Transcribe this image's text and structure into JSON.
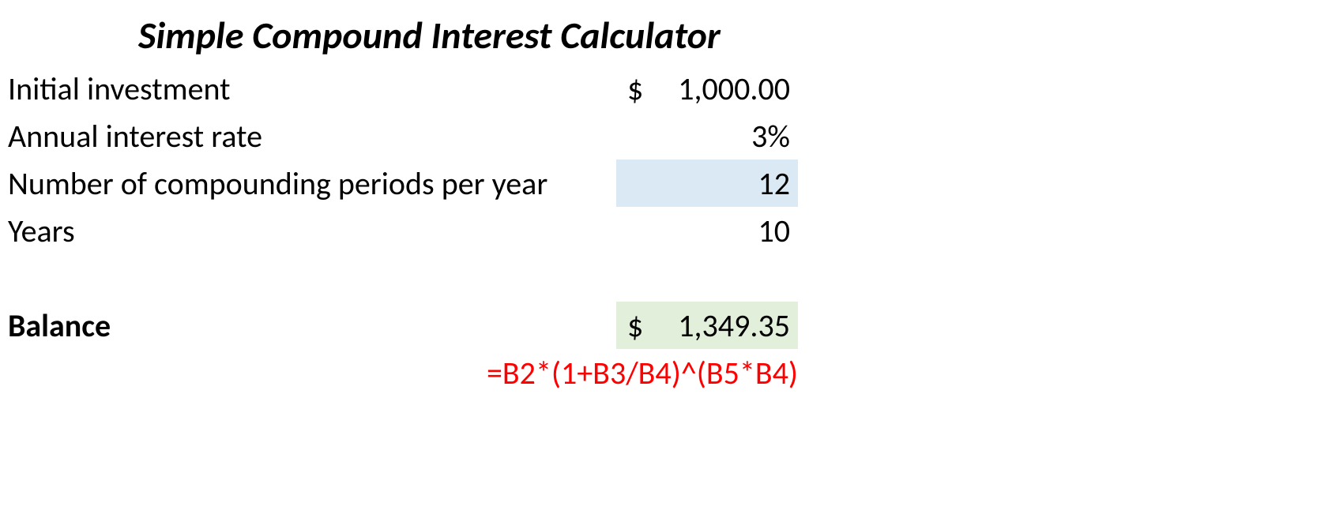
{
  "title": "Simple Compound Interest Calculator",
  "rows": {
    "initial": {
      "label": "Initial investment",
      "currency": "$",
      "value": "1,000.00"
    },
    "rate": {
      "label": "Annual interest rate",
      "value": "3%"
    },
    "periods": {
      "label": "Number of compounding periods per year",
      "value": "12"
    },
    "years": {
      "label": "Years",
      "value": "10"
    },
    "balance": {
      "label": "Balance",
      "currency": "$",
      "value": "1,349.35"
    }
  },
  "formula": "=B2*(1+B3/B4)^(B5*B4)"
}
